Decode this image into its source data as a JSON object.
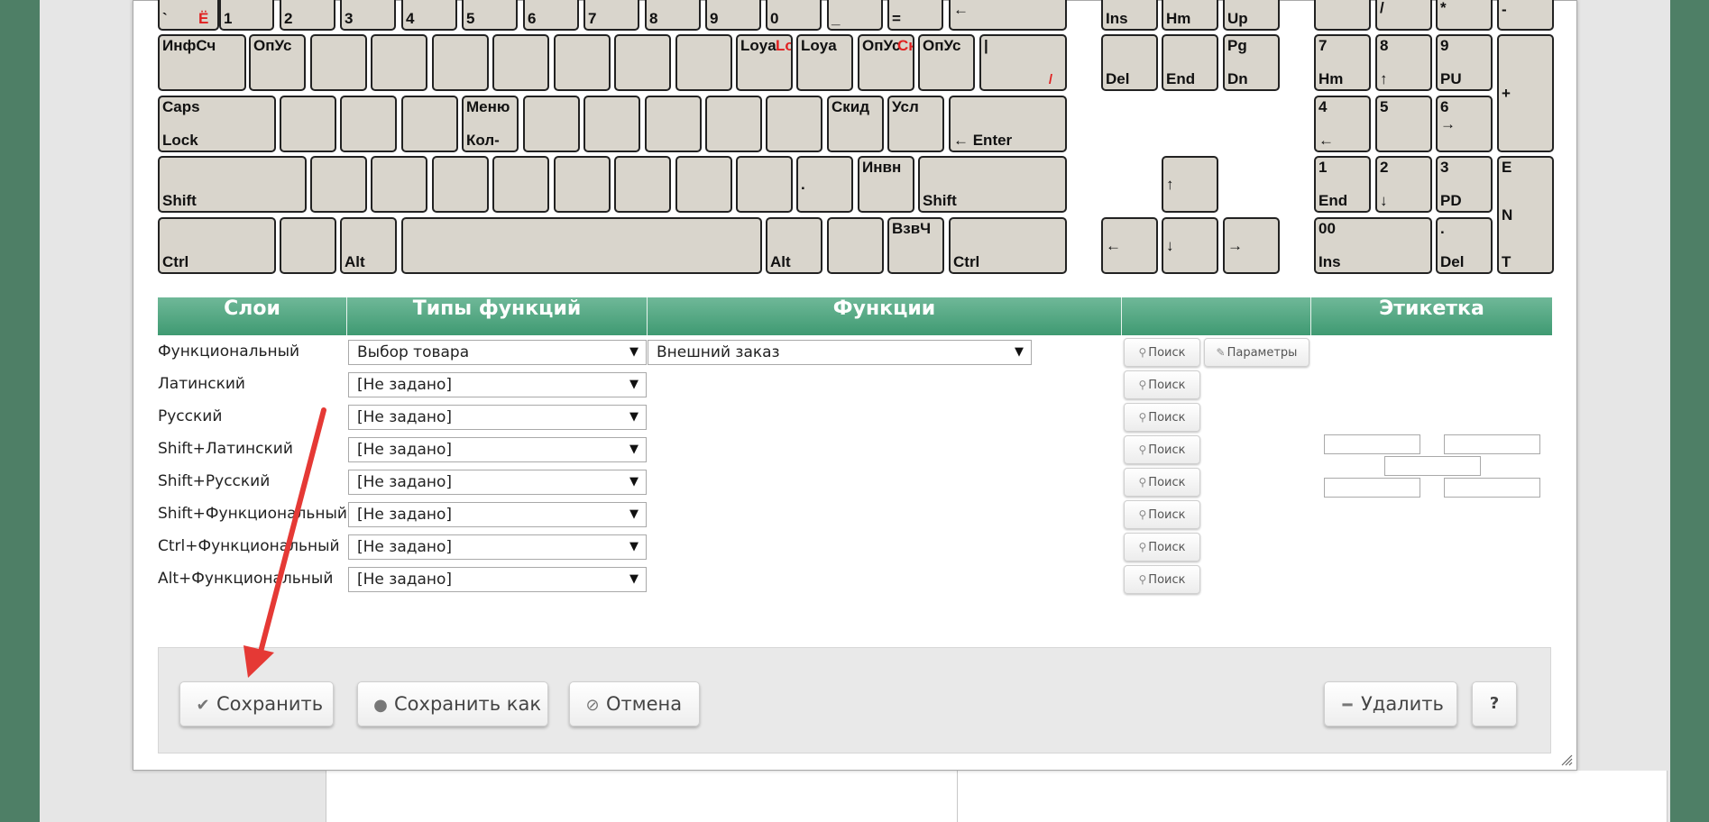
{
  "keyboard": {
    "r0": [
      "`",
      "Ё",
      "1",
      "2",
      "3",
      "4",
      "5",
      "6",
      "7",
      "8",
      "9",
      "0",
      "_",
      "=",
      "←",
      "Ins",
      "Hm",
      "Up",
      "/",
      "*",
      "-"
    ],
    "r1": {
      "k1": "ИнфСч",
      "k2": "ОпУс",
      "k10a": "Loya",
      "k10b": "Lo",
      "k11": "Loya",
      "k12a": "ОпУс",
      "k12b": "Ск",
      "k13": "ОпУс",
      "k14": "|",
      "k14b": "/",
      "del": "Del",
      "end": "End",
      "pg": "Pg",
      "dn": "Dn",
      "n7a": "7",
      "n7b": "Hm",
      "n8a": "8",
      "n8b": "↑",
      "n9a": "9",
      "n9b": "PU",
      "plus": "+"
    },
    "r2": {
      "capsA": "Caps",
      "capsB": "Lock",
      "menuA": "Меню",
      "menuB": "Кол-",
      "skid": "Скид",
      "usl": "Усл",
      "enter": "← Enter",
      "n4a": "4",
      "n4b": "←",
      "n5": "5",
      "n6a": "6",
      "n6b": "→"
    },
    "r3": {
      "shiftL": "Shift",
      "dot": ".",
      "invn": "Инвн",
      "shiftR": "Shift",
      "up": "↑",
      "n1a": "1",
      "n1b": "End",
      "n2a": "2",
      "n2b": "↓",
      "n3a": "3",
      "n3b": "PD",
      "e1": "E",
      "e2": "N",
      "e3": "T"
    },
    "r4": {
      "ctrlL": "Ctrl",
      "altL": "Alt",
      "altR": "Alt",
      "vzvch": "ВзвЧ",
      "ctrlR": "Ctrl",
      "left": "←",
      "down": "↓",
      "right": "→",
      "n00a": "00",
      "n00b": "Ins",
      "ndotA": ".",
      "ndotB": "Del"
    }
  },
  "table": {
    "headers": [
      "Слои",
      "Типы функций",
      "Функции",
      "",
      "Этикетка"
    ],
    "rows": [
      {
        "layer": "Функциональный",
        "type": "Выбор товара",
        "function": "Внешний заказ"
      },
      {
        "layer": "Латинский",
        "type": "[Не задано]"
      },
      {
        "layer": "Русский",
        "type": "[Не задано]"
      },
      {
        "layer": "Shift+Латинский",
        "type": "[Не задано]"
      },
      {
        "layer": "Shift+Русский",
        "type": "[Не задано]"
      },
      {
        "layer": "Shift+Функциональный",
        "type": "[Не задано]"
      },
      {
        "layer": "Ctrl+Функциональный",
        "type": "[Не задано]"
      },
      {
        "layer": "Alt+Функциональный",
        "type": "[Не задано]"
      }
    ],
    "search_label": "Поиск",
    "params_label": "Параметры"
  },
  "footer": {
    "save": "Сохранить",
    "save_as": "Сохранить как",
    "cancel": "Отмена",
    "delete": "Удалить",
    "help": "?"
  },
  "colors": {
    "header_green": "#4fa882",
    "key_face": "#d9d5cc",
    "annotation_red": "#e53935",
    "background_green": "#4e7f66"
  }
}
